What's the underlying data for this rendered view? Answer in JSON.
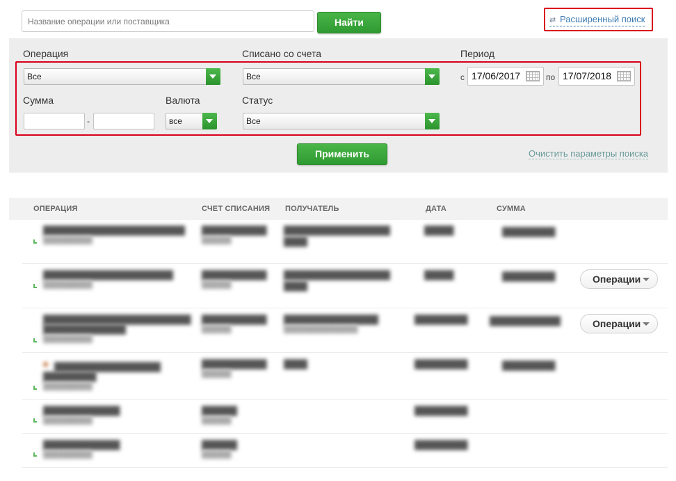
{
  "search": {
    "placeholder": "Название операции или поставщика",
    "find_label": "Найти"
  },
  "advanced_search": {
    "label": "Расширенный поиск",
    "icon": "filter-settings-icon"
  },
  "filters": {
    "operation": {
      "label": "Операция",
      "value": "Все"
    },
    "account": {
      "label": "Списано со счета",
      "value": "Все"
    },
    "period": {
      "label": "Период",
      "from_prefix": "с",
      "to_prefix": "по",
      "from": "17/06/2017",
      "to": "17/07/2018"
    },
    "amount": {
      "label": "Сумма",
      "separator": "-"
    },
    "currency": {
      "label": "Валюта",
      "value": "все"
    },
    "status": {
      "label": "Статус",
      "value": "Все"
    },
    "apply_label": "Применить",
    "clear_label": "Очистить параметры поиска"
  },
  "table": {
    "headers": [
      "ОПЕРАЦИЯ",
      "СЧЕТ СПИСАНИЯ",
      "ПОЛУЧАТЕЛЬ",
      "ДАТА",
      "СУММА"
    ],
    "row_action_label": "Операции"
  },
  "colors": {
    "accent_green": "#34a033",
    "highlight_red": "#d9001b",
    "link_blue": "#3d7cb3"
  }
}
